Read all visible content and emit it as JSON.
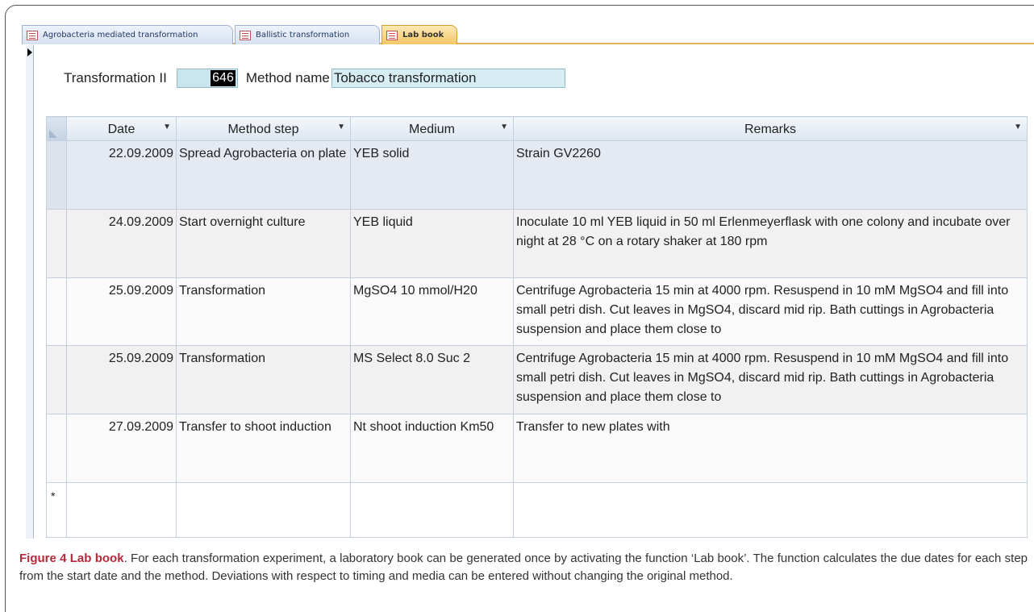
{
  "tabs": [
    {
      "label": "Agrobacteria mediated transformation"
    },
    {
      "label": "Ballistic transformation"
    },
    {
      "label": "Lab book"
    }
  ],
  "form": {
    "transformation_label": "Transformation II",
    "transformation_id": "646",
    "method_label": "Method name",
    "method_value": "Tobacco transformation"
  },
  "table": {
    "columns": [
      "Date",
      "Method step",
      "Medium",
      "Remarks"
    ],
    "rows": [
      {
        "date": "22.09.2009",
        "step": "Spread Agrobacteria on plate",
        "medium": "YEB solid",
        "remarks": "Strain GV2260"
      },
      {
        "date": "24.09.2009",
        "step": "Start overnight culture",
        "medium": "YEB liquid",
        "remarks": "Inoculate 10 ml YEB liquid in 50 ml Erlenmeyerflask with one colony and incubate over night at 28 °C on a rotary shaker at 180 rpm"
      },
      {
        "date": "25.09.2009",
        "step": "Transformation",
        "medium": "MgSO4 10 mmol/H20",
        "remarks": "Centrifuge Agrobacteria 15 min at 4000 rpm. Resuspend in 10 mM MgSO4 and fill into small petri dish. Cut leaves in MgSO4, discard mid rip. Bath cuttings in Agrobacteria suspension and place them close to"
      },
      {
        "date": "25.09.2009",
        "step": "Transformation",
        "medium": "MS Select 8.0 Suc 2",
        "remarks": "Centrifuge Agrobacteria 15 min at 4000 rpm. Resuspend in 10 mM MgSO4 and fill into small petri dish. Cut leaves in MgSO4, discard mid rip. Bath cuttings in Agrobacteria suspension and place them close to"
      },
      {
        "date": "27.09.2009",
        "step": "Transfer to shoot induction",
        "medium": "Nt shoot induction Km50",
        "remarks": "Transfer to new plates with"
      }
    ],
    "new_row_marker": "*"
  },
  "caption": {
    "label": "Figure 4 Lab book",
    "text": ". For each transformation experiment, a laboratory book can be generated once by activating the function ‘Lab book’. The function calculates the due dates for each step from the start date and the method. Deviations with respect to timing and media can be entered without changing the original method."
  }
}
